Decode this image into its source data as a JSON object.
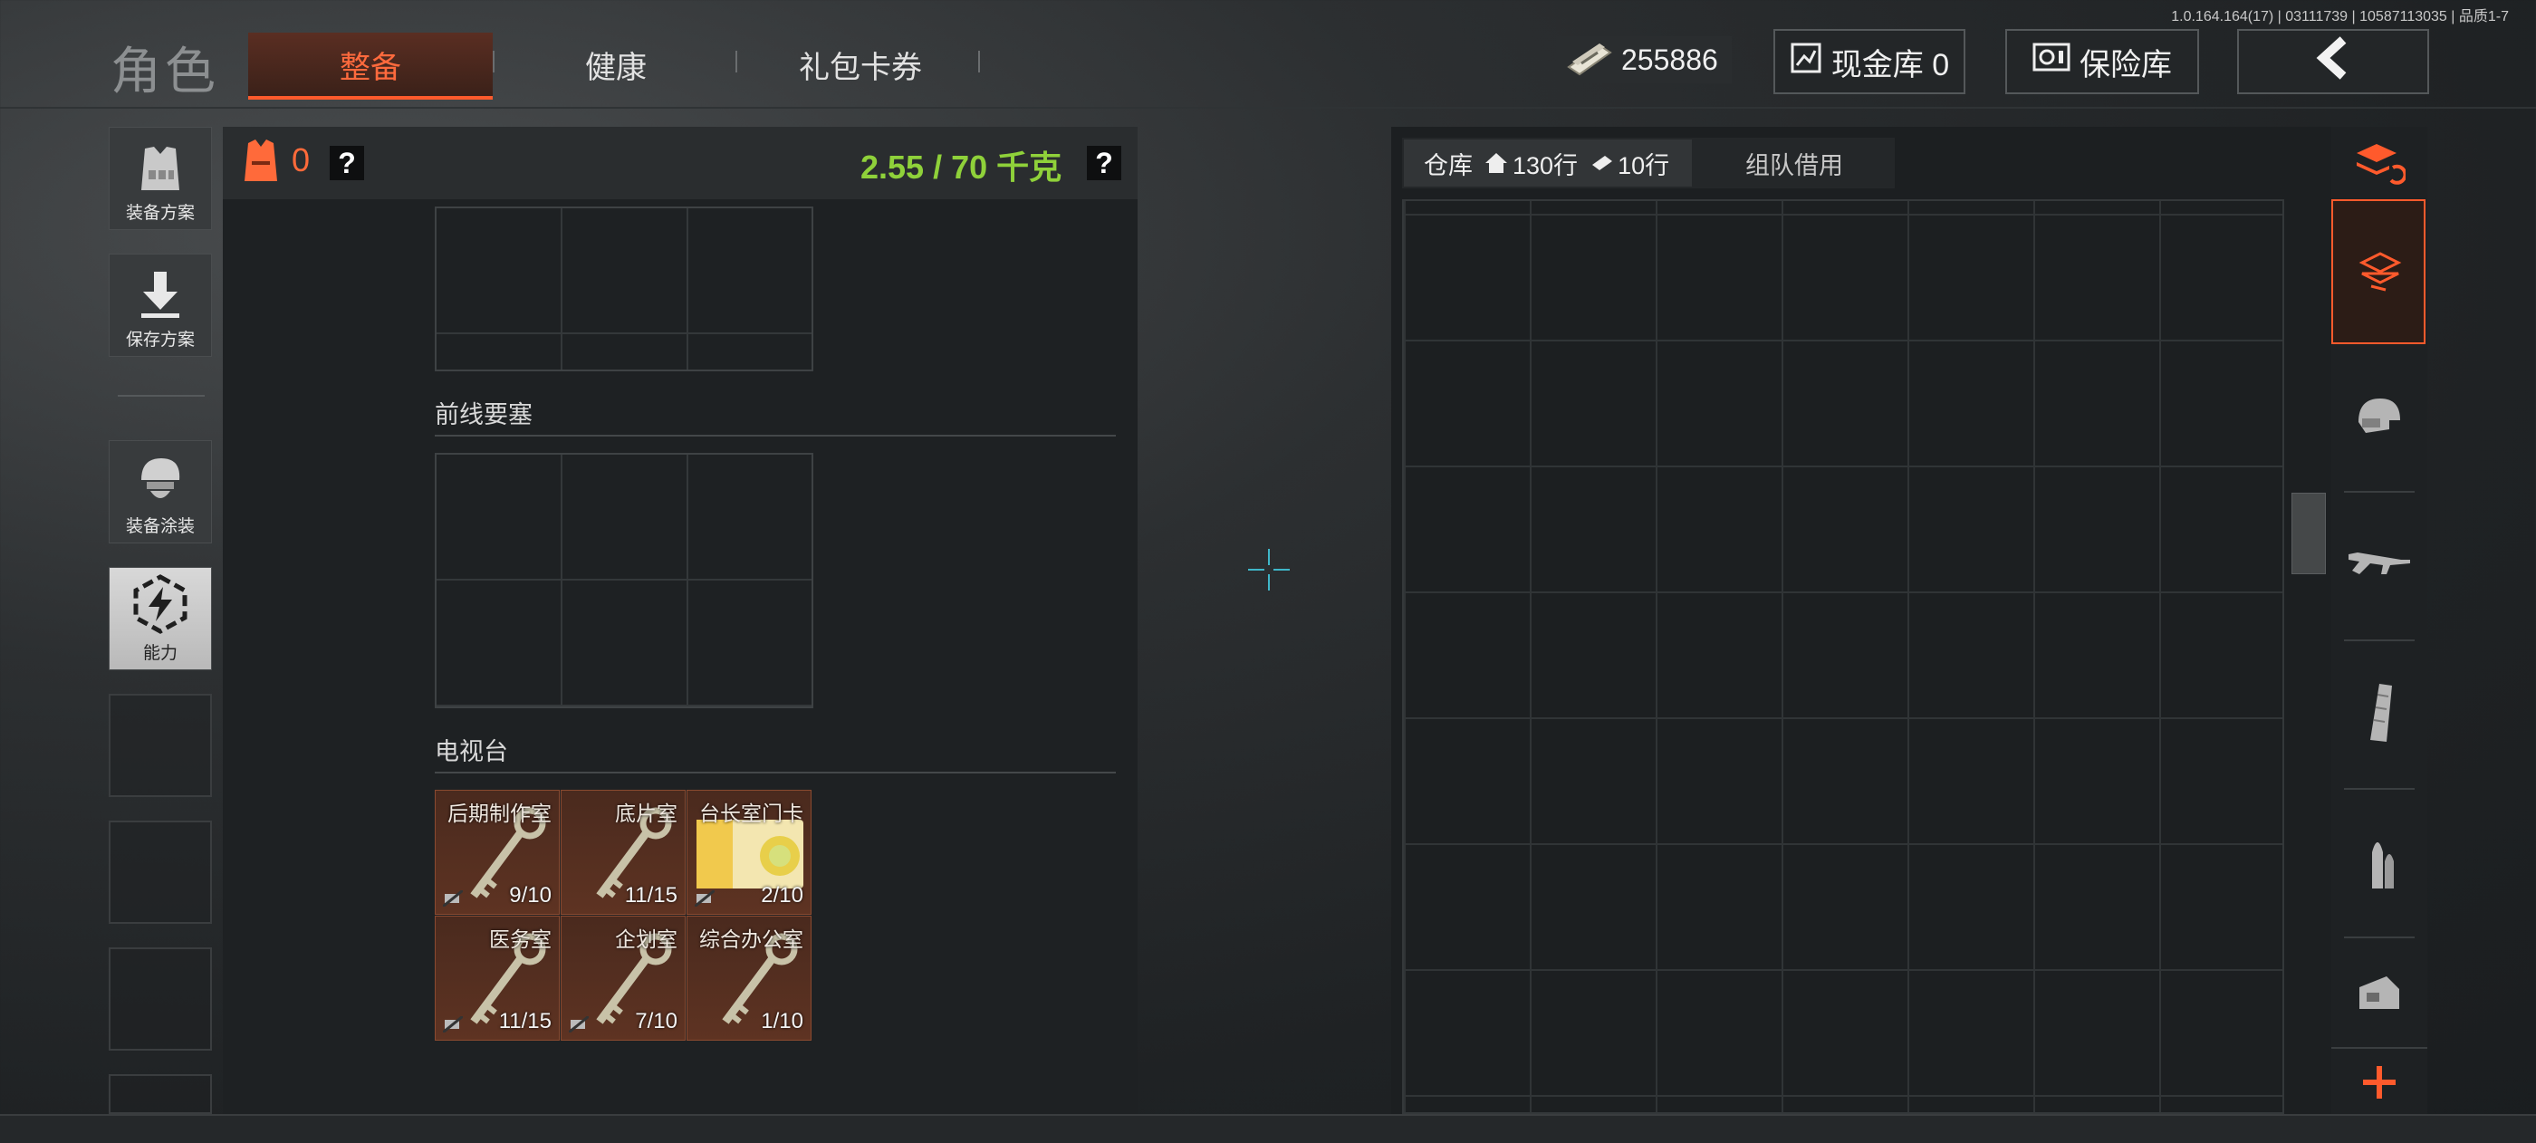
{
  "header": {
    "title": "角色",
    "tabs": [
      {
        "label": "整备",
        "active": true
      },
      {
        "label": "健康",
        "active": false
      },
      {
        "label": "礼包卡券",
        "active": false
      }
    ],
    "version": "1.0.164.164(17) | 03111739 | 10587113035 | 品质1-7",
    "money": "255886",
    "cash_vault_label": "现金库 0",
    "safe_vault_label": "保险库"
  },
  "sidebar": {
    "items": [
      {
        "label": "装备方案",
        "icon": "vest-icon"
      },
      {
        "label": "保存方案",
        "icon": "download-icon"
      },
      {
        "label": "装备涂装",
        "icon": "helmet-icon"
      },
      {
        "label": "能力",
        "icon": "ability-icon"
      }
    ]
  },
  "equipment": {
    "armor_count": "0",
    "weight": "2.55 / 70 千克",
    "help_mark": "?",
    "sections": [
      {
        "title": "前线要塞"
      },
      {
        "title": "电视台"
      }
    ],
    "keys": [
      {
        "name": "后期制作室",
        "count": "9/10"
      },
      {
        "name": "底片室",
        "count": "11/15"
      },
      {
        "name": "台长室门卡",
        "count": "2/10"
      },
      {
        "name": "医务室",
        "count": "11/15"
      },
      {
        "name": "企划室",
        "count": "7/10"
      },
      {
        "name": "综合办公室",
        "count": "1/10"
      }
    ]
  },
  "warehouse": {
    "tab_label": "仓库",
    "rows_label": "130行",
    "extra_label": "10行",
    "team_tab_label": "组队借用"
  },
  "categories": [
    "stack-refresh-icon",
    "all-items-icon",
    "helmet-icon",
    "rifle-icon",
    "magazine-icon",
    "ammo-icon",
    "scope-icon",
    "add-icon"
  ],
  "colors": {
    "accent": "#ff5a2c",
    "weight_green": "#8fd13a"
  }
}
